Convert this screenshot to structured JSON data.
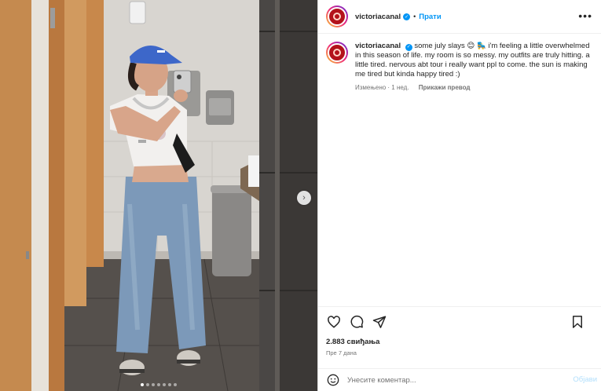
{
  "post": {
    "username": "victoriacanal",
    "separator": "•",
    "follow_label": "Прати",
    "more_label": "•••",
    "caption": {
      "username": "victoriacanal",
      "text": "some july slays 😊 🛼 i'm feeling a little overwhelmed in this season of life. my room is so messy. my outfits are truly hitting. a little tired. nervous abt tour i really want ppl to come. the sun is making me tired but kinda happy tired :)",
      "edited": "Измењено · 1 нед.",
      "translate": "Прикажи превод"
    },
    "likes": "2.883 свиђања",
    "date": "Пре 7 дана",
    "comment": {
      "placeholder": "Унесите коментар...",
      "post_label": "Објави"
    },
    "carousel": {
      "next_glyph": "›",
      "total": 7,
      "current": 1
    }
  },
  "colors": {
    "accent": "#0095f6",
    "post_disabled": "#b2dffc",
    "muted": "#737373"
  },
  "icons": [
    "verified-badge-icon",
    "heart-icon",
    "comment-icon",
    "share-icon",
    "bookmark-icon",
    "emoji-icon",
    "chevron-right-icon"
  ]
}
